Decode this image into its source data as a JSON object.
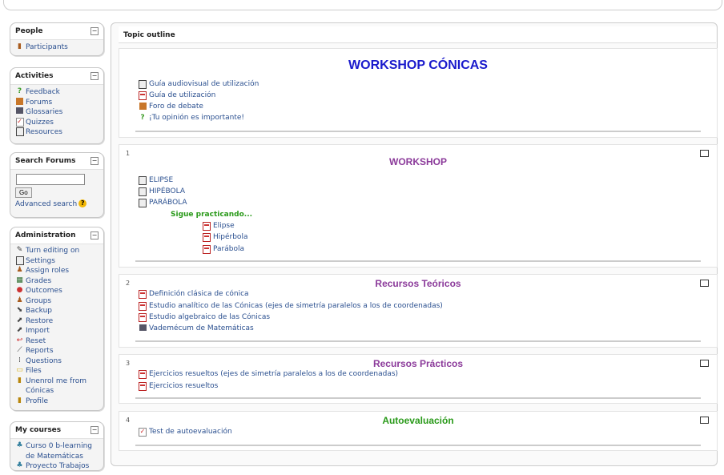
{
  "blocks": {
    "people": {
      "title": "People",
      "items": [
        {
          "label": "Participants",
          "icon": "participants-icon"
        }
      ]
    },
    "activities": {
      "title": "Activities",
      "items": [
        {
          "label": "Feedback",
          "icon": "feedback-icon"
        },
        {
          "label": "Forums",
          "icon": "forum-icon"
        },
        {
          "label": "Glossaries",
          "icon": "glossary-icon"
        },
        {
          "label": "Quizzes",
          "icon": "quiz-icon"
        },
        {
          "label": "Resources",
          "icon": "resource-icon"
        }
      ]
    },
    "search": {
      "title": "Search Forums",
      "button": "Go",
      "advanced": "Advanced search"
    },
    "administration": {
      "title": "Administration",
      "items": [
        {
          "label": "Turn editing on"
        },
        {
          "label": "Settings"
        },
        {
          "label": "Assign roles"
        },
        {
          "label": "Grades"
        },
        {
          "label": "Outcomes"
        },
        {
          "label": "Groups"
        },
        {
          "label": "Backup"
        },
        {
          "label": "Restore"
        },
        {
          "label": "Import"
        },
        {
          "label": "Reset"
        },
        {
          "label": "Reports"
        },
        {
          "label": "Questions"
        },
        {
          "label": "Files"
        },
        {
          "label": "Unenrol me from Cónicas"
        },
        {
          "label": "Profile"
        }
      ]
    },
    "mycourses": {
      "title": "My courses",
      "items": [
        {
          "label": "Curso 0 b-learning de Matemáticas"
        },
        {
          "label": "Proyecto Trabajos"
        }
      ]
    }
  },
  "main": {
    "outline_title": "Topic outline",
    "section0": {
      "title": "WORKSHOP CÓNICAS",
      "title_color": "#1a1acc",
      "items": [
        "Guía audiovisual de utilización",
        "Guía de utilización",
        "Foro de debate",
        "¡Tu opinión es importante!"
      ]
    },
    "section1": {
      "num": "1",
      "title": "WORKSHOP",
      "title_color": "#8b3a9a",
      "items": [
        "ELIPSE",
        "HIPÉBOLA",
        "PARÁBOLA"
      ],
      "subheading": "Sigue practicando...",
      "subitems": [
        "Elipse",
        "Hipérbola",
        "Parábola"
      ]
    },
    "section2": {
      "num": "2",
      "title": "Recursos Teóricos",
      "title_color": "#8b3a9a",
      "items": [
        "Definición clásica de cónica",
        "Estudio analítico de las Cónicas (ejes de simetría paralelos a los de coordenadas)",
        "Estudio algebraico de las Cónicas",
        "Vademécum de Matemáticas"
      ]
    },
    "section3": {
      "num": "3",
      "title": "Recursos Prácticos",
      "title_color": "#8b3a9a",
      "items": [
        "Ejercicios resueltos (ejes de simetría paralelos a los de coordenadas)",
        "Ejercicios resueltos"
      ]
    },
    "section4": {
      "num": "4",
      "title": "Autoevaluación",
      "title_color": "#2a9a1a",
      "items": [
        "Test de autoevaluación"
      ]
    }
  }
}
